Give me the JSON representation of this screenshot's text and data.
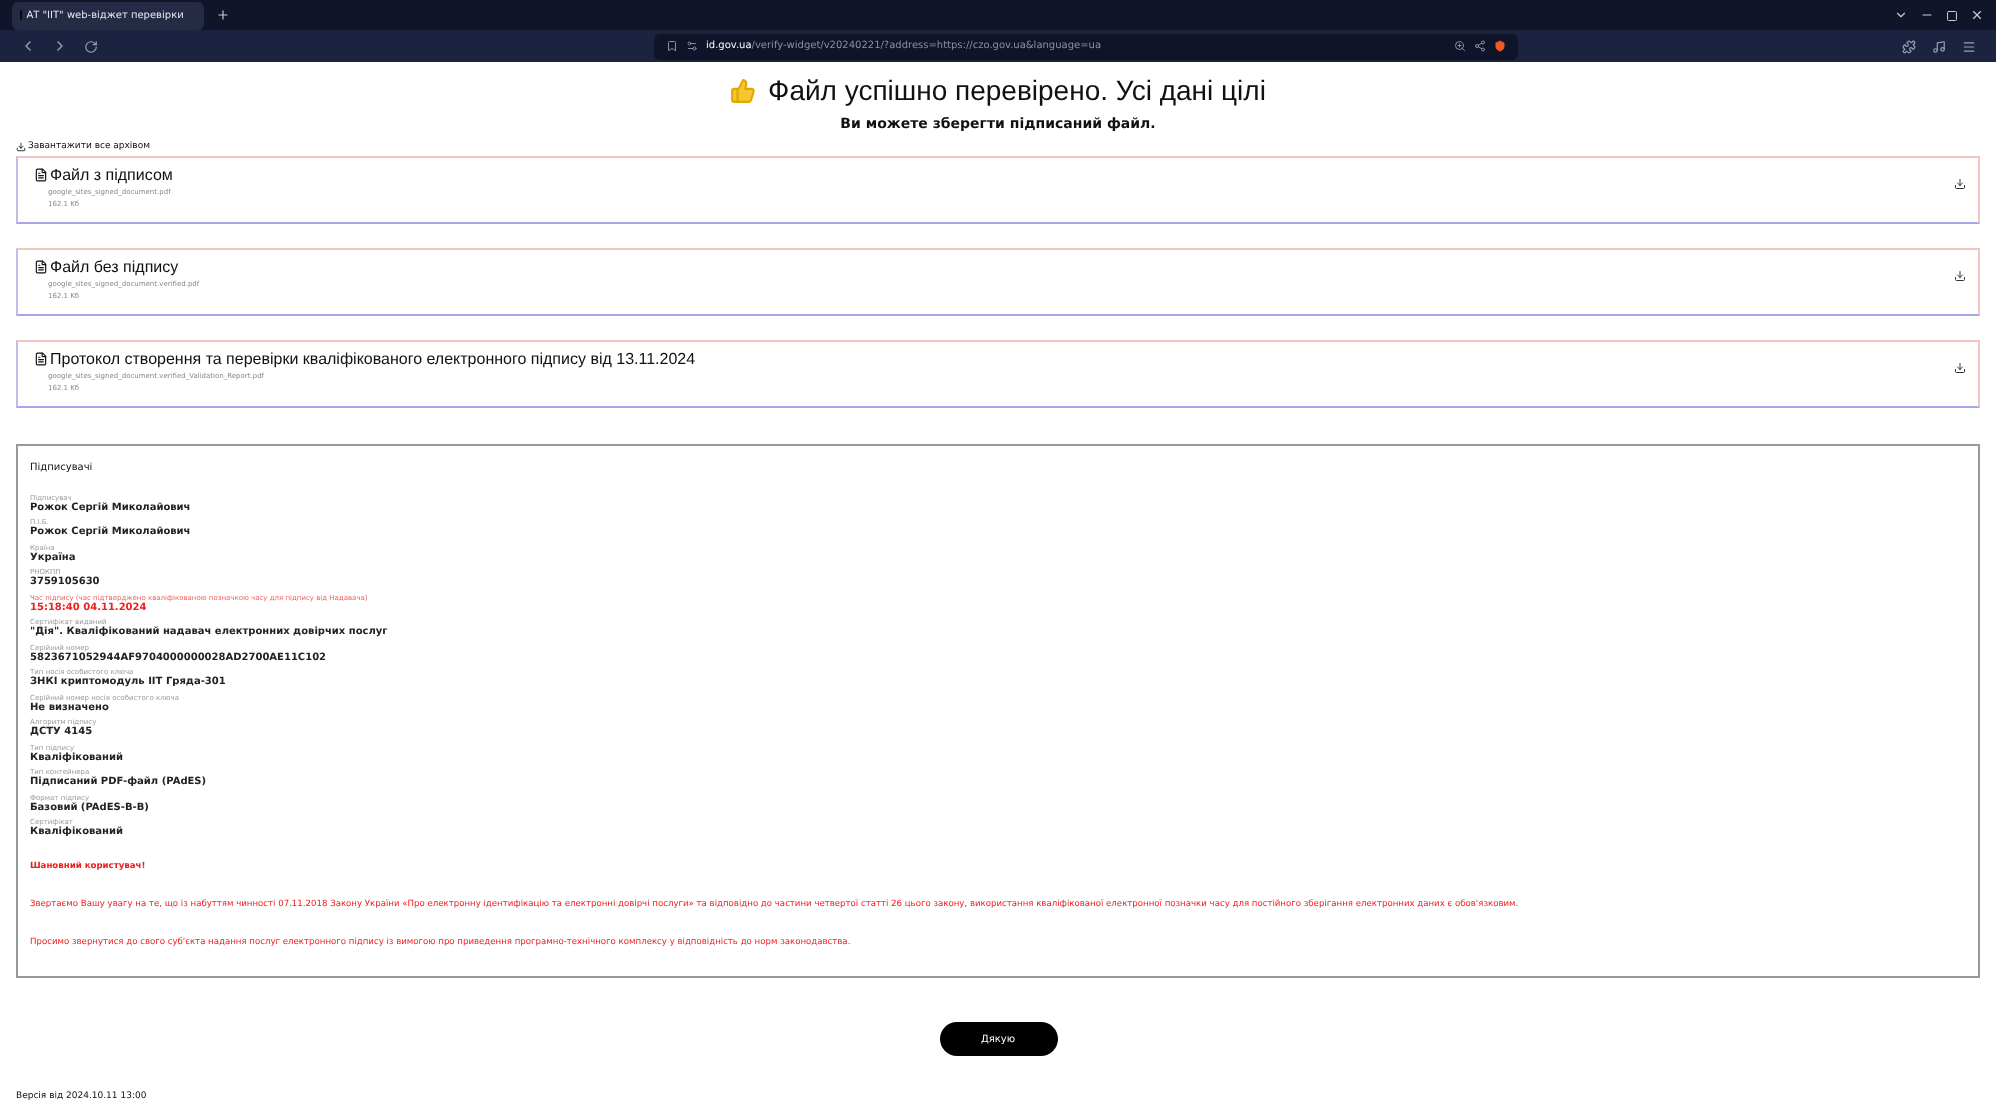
{
  "browser": {
    "tab_title": "АТ \"ІІТ\" web-віджет перевірки",
    "url_host": "id.gov.ua",
    "url_path": "/verify-widget/v20240221/?address=https://czo.gov.ua&language=ua"
  },
  "title": "Файл успішно перевірено. Усі дані цілі",
  "subtitle": "Ви можете зберегти підписаний файл.",
  "download_all": "Завантажити все архівом",
  "files": [
    {
      "title": "Файл з підписом",
      "filename": "google_sites_signed_document.pdf",
      "size": "162.1 Kб"
    },
    {
      "title": "Файл без підпису",
      "filename": "google_sites_signed_document.verified.pdf",
      "size": "162.1 Kб"
    },
    {
      "title": "Протокол створення та перевірки кваліфікованого електронного підпису від 13.11.2024",
      "filename": "google_sites_signed_document.verified_Validation_Report.pdf",
      "size": "162.1 Kб"
    }
  ],
  "signers": {
    "heading": "Підписувачі",
    "fields": [
      {
        "label": "Підписувач",
        "value": "Рожок Сергій Миколайович",
        "highlight": false
      },
      {
        "label": "П.І.Б.",
        "value": "Рожок Сергій Миколайович",
        "highlight": false
      },
      {
        "label": "Країна",
        "value": "Україна",
        "highlight": false
      },
      {
        "label": "РНОКПП",
        "value": "3759105630",
        "highlight": false
      },
      {
        "label": "Час підпису (час підтверджено кваліфікованою позначкою часу для підпису від Надавача)",
        "value": "15:18:40 04.11.2024",
        "highlight": true
      },
      {
        "label": "Сертифікат виданий",
        "value": "\"Дія\". Кваліфікований надавач електронних довірчих послуг",
        "highlight": false
      },
      {
        "label": "Серійний номер",
        "value": "5823671052944AF9704000000028AD2700AE11C102",
        "highlight": false
      },
      {
        "label": "Тип носія особистого ключа",
        "value": "ЗНКІ криптомодуль ІІТ Гряда-301",
        "highlight": false
      },
      {
        "label": "Серійний номер носія особистого ключа",
        "value": "Не визначено",
        "highlight": false
      },
      {
        "label": "Алгоритм підпису",
        "value": "ДСТУ 4145",
        "highlight": false
      },
      {
        "label": "Тип підпису",
        "value": "Кваліфікований",
        "highlight": false
      },
      {
        "label": "Тип контейнера",
        "value": "Підписаний PDF-файл (PAdES)",
        "highlight": false
      },
      {
        "label": "Формат підпису",
        "value": "Базовий (PAdES-B-B)",
        "highlight": false
      },
      {
        "label": "Сертифікат",
        "value": "Кваліфікований",
        "highlight": false
      }
    ]
  },
  "notice": [
    "Шановний користувач!",
    "Звертаємо Вашу увагу на те, що із набуттям чинності 07.11.2018 Закону України «Про електронну ідентифікацію та електронні довірчі послуги» та відповідно до частини четвертої статті 26 цього закону, використання кваліфікованої електронної позначки часу для постійного зберігання електронних даних є обов'язковим.",
    "Просимо звернутися до свого суб'єкта надання послуг електронного підпису із вимогою про приведення програмно-технічного комплексу у відповідність до норм законодавства."
  ],
  "button": "Дякую",
  "version": "Версія від 2024.10.11 13:00"
}
